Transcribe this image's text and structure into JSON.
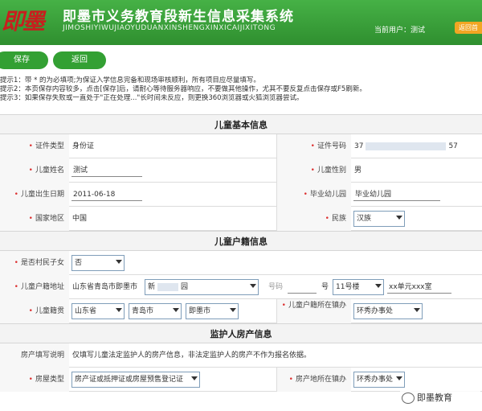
{
  "header": {
    "logo_text": "即墨",
    "title": "即墨市义务教育段新生信息采集系统",
    "subtitle": "JIMOSHIYIWUJIAOYUDUANXINSHENGXINXICAIJIXITONG",
    "current_user_label": "当前用户：测试",
    "return_label": "返回首"
  },
  "toolbar": {
    "save_label": "保存",
    "back_label": "返回"
  },
  "tips": [
    "提示1：带 * 的为必填项;为保证入学信息完备和现场审核顺利，所有项目应尽量填写。",
    "提示2：本页保存内容较多，点击[保存]后，请耐心等待服务器响应，不要做其他操作，尤其不要反复点击保存或F5刷新。",
    "提示3：如果保存失败或一直处于\"正在处理...\"长时间未反应，则更换360浏览器或火狐浏览器尝试。"
  ],
  "sections": {
    "child_basic": "儿童基本信息",
    "child_household": "儿童户籍信息",
    "guardian_property": "监护人房产信息"
  },
  "child_basic": {
    "id_type_label": "证件类型",
    "id_type_value": "身份证",
    "id_number_label": "证件号码",
    "id_number_prefix": "37",
    "id_number_suffix": "57",
    "name_label": "儿童姓名",
    "name_value": "测试",
    "gender_label": "儿童性别",
    "gender_value": "男",
    "birth_label": "儿童出生日期",
    "birth_value": "2011-06-18",
    "kindergarten_label": "毕业幼儿园",
    "kindergarten_value": "毕业幼儿园",
    "country_label": "国家地区",
    "country_value": "中国",
    "ethnicity_label": "民族",
    "ethnicity_value": "汉族"
  },
  "child_household": {
    "rural_label": "是否村民子女",
    "rural_value": "否",
    "address_label": "儿童户籍地址",
    "address_prefix": "山东省青岛市即墨市",
    "address_select": "新",
    "address_select_suffix": "园",
    "number_label": "号码",
    "hao_label": "号",
    "building_select": "11号楼",
    "unit_text": "xx单元xxx室",
    "native_label": "儿童籍贯",
    "province": "山东省",
    "city": "青岛市",
    "county": "即墨市",
    "office_label": "儿童户籍所在镇办",
    "office_value": "环秀办事处"
  },
  "guardian_property": {
    "note_label": "房产填写说明",
    "note_value": "仅填写儿童法定监护人的房产信息，非法定监护人的房产不作为报名依据。",
    "type_label": "房屋类型",
    "type_value": "房产证或抵押证或房屋预售登记证",
    "office_label": "房产地所在镇办",
    "office_value": "环秀办事处"
  },
  "watermark": {
    "text": "即墨教育"
  }
}
